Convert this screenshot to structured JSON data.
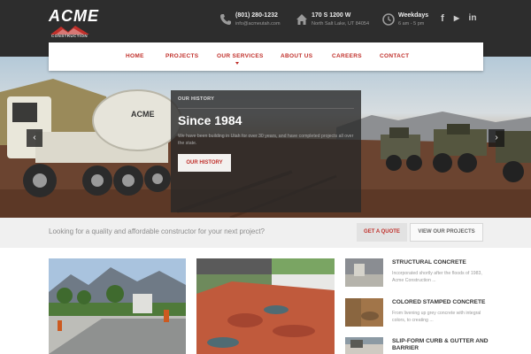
{
  "header": {
    "logo_word": "ACME",
    "logo_sub": "CONSTRUCTION",
    "phone": {
      "main": "(801) 280-1232",
      "sub": "info@acmeutah.com",
      "icon": "phone-icon"
    },
    "address": {
      "main": "170 S 1200 W",
      "sub": "North Salt Lake, UT 84054",
      "icon": "home-icon"
    },
    "hours": {
      "main": "Weekdays",
      "sub": "6 am - 5 pm",
      "icon": "clock-icon"
    },
    "social": [
      {
        "name": "facebook-icon",
        "glyph": "f"
      },
      {
        "name": "youtube-icon",
        "glyph": "▶"
      },
      {
        "name": "linkedin-icon",
        "glyph": "in"
      }
    ]
  },
  "nav": {
    "items": [
      {
        "label": "HOME"
      },
      {
        "label": "PROJECTS"
      },
      {
        "label": "OUR SERVICES"
      },
      {
        "label": "ABOUT US"
      },
      {
        "label": "CAREERS"
      },
      {
        "label": "CONTACT"
      }
    ]
  },
  "hero": {
    "kicker": "OUR HISTORY",
    "title": "Since 1984",
    "text": "We have been building in Utah for over 30 years, and have completed projects all over the state.",
    "button": "OUR HISTORY",
    "prev": "‹",
    "next": "›",
    "truck_brand": "ACME"
  },
  "cta": {
    "text": "Looking for a quality and affordable constructor for your next project?",
    "quote_button": "GET A QUOTE",
    "projects_button": "VIEW OUR PROJECTS"
  },
  "services": [
    {
      "title": "STRUCTURAL CONCRETE",
      "desc": "Incorporated shortly after the floods of 1983, Acme Construction ..."
    },
    {
      "title": "COLORED STAMPED CONCRETE",
      "desc": "From livening up grey concrete with integral colors, to creating ..."
    },
    {
      "title": "SLIP-FORM CURB & GUTTER AND BARRIER",
      "desc": ""
    }
  ],
  "colors": {
    "accent": "#c0302b",
    "topbar": "#2d2d2d"
  }
}
